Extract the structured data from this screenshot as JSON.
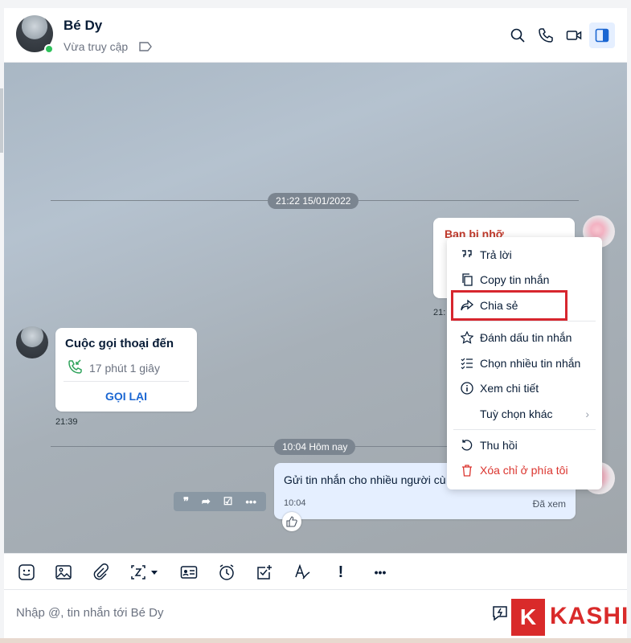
{
  "header": {
    "name": "Bé Dy",
    "status": "Vừa truy cập",
    "icons": [
      "search-icon",
      "phone-icon",
      "video-icon",
      "sidebar-toggle-icon"
    ]
  },
  "chat": {
    "divider1_time": "21:22 15/01/2022",
    "reminder_title": "Bạn bị nhỡ",
    "reminder_time": "21:",
    "call": {
      "title": "Cuộc gọi thoại đến",
      "duration": "17 phút 1 giây",
      "callback_label": "GỌI LẠI",
      "time": "21:39"
    },
    "divider2_time": "10:04 Hôm nay",
    "my_message": {
      "text": "Gửi tin nhắn cho nhiều người cù",
      "time": "10:04",
      "status": "Đã xem"
    }
  },
  "context_menu": {
    "items": [
      {
        "label": "Trả lời",
        "icon": "quote-icon"
      },
      {
        "label": "Copy tin nhắn",
        "icon": "copy-icon"
      },
      {
        "label": "Chia sẻ",
        "icon": "share-icon"
      },
      {
        "label": "Đánh dấu tin nhắn",
        "icon": "star-icon"
      },
      {
        "label": "Chọn nhiều tin nhắn",
        "icon": "multi-select-icon"
      },
      {
        "label": "Xem chi tiết",
        "icon": "info-icon"
      },
      {
        "label": "Tuỳ chọn khác",
        "icon": ""
      },
      {
        "label": "Thu hồi",
        "icon": "recall-icon"
      },
      {
        "label": "Xóa chỉ ở phía tôi",
        "icon": "trash-icon"
      }
    ],
    "highlight_color": "#d7262e"
  },
  "toolbar": {
    "icons": [
      "sticker-icon",
      "image-icon",
      "attachment-icon",
      "screenshot-icon",
      "contact-card-icon",
      "reminder-icon",
      "task-icon",
      "text-format-icon",
      "important-icon",
      "more-icon"
    ],
    "important_label": "!",
    "more_label": "•••"
  },
  "composer": {
    "placeholder": "Nhập @, tin nhắn tới Bé Dy"
  },
  "watermark": {
    "k": "K",
    "text": "KASHI"
  },
  "colors": {
    "accent": "#1a66d2",
    "danger": "#db342e",
    "bubble_mine": "#e5efff"
  }
}
